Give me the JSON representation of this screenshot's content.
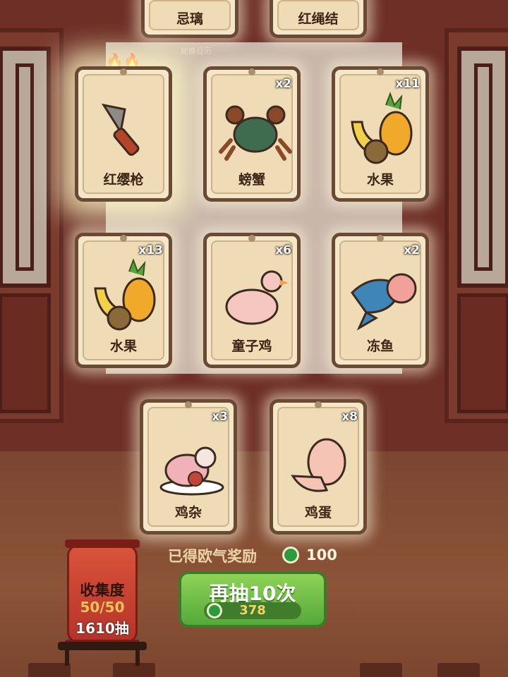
{
  "top_cards": [
    {
      "name": "忌璃"
    },
    {
      "name": "红绳结"
    }
  ],
  "small_caption": "轮换日历",
  "cards": [
    {
      "name": "红缨枪",
      "count": "",
      "art": "spear-icon",
      "glow": true
    },
    {
      "name": "螃蟹",
      "count": "x2",
      "art": "crab-icon"
    },
    {
      "name": "水果",
      "count": "x11",
      "art": "fruit-icon"
    },
    {
      "name": "水果",
      "count": "x13",
      "art": "fruit-icon"
    },
    {
      "name": "童子鸡",
      "count": "x6",
      "art": "chicken-icon"
    },
    {
      "name": "冻鱼",
      "count": "x2",
      "art": "fish-icon"
    },
    {
      "name": "鸡杂",
      "count": "x3",
      "art": "chicken-plate-icon"
    },
    {
      "name": "鸡蛋",
      "count": "x8",
      "art": "egg-icon"
    }
  ],
  "reward": {
    "label": "已得欧气奖励",
    "value": "100"
  },
  "draw_button": {
    "label": "再抽10次",
    "cost": "378"
  },
  "collection": {
    "title": "收集度",
    "progress": "50/50",
    "draws": "1610抽"
  },
  "colors": {
    "card_bg": "#f4e6c8",
    "card_border": "#6b4a33",
    "button_green": "#6cbf45",
    "lantern_red": "#c6432f"
  }
}
